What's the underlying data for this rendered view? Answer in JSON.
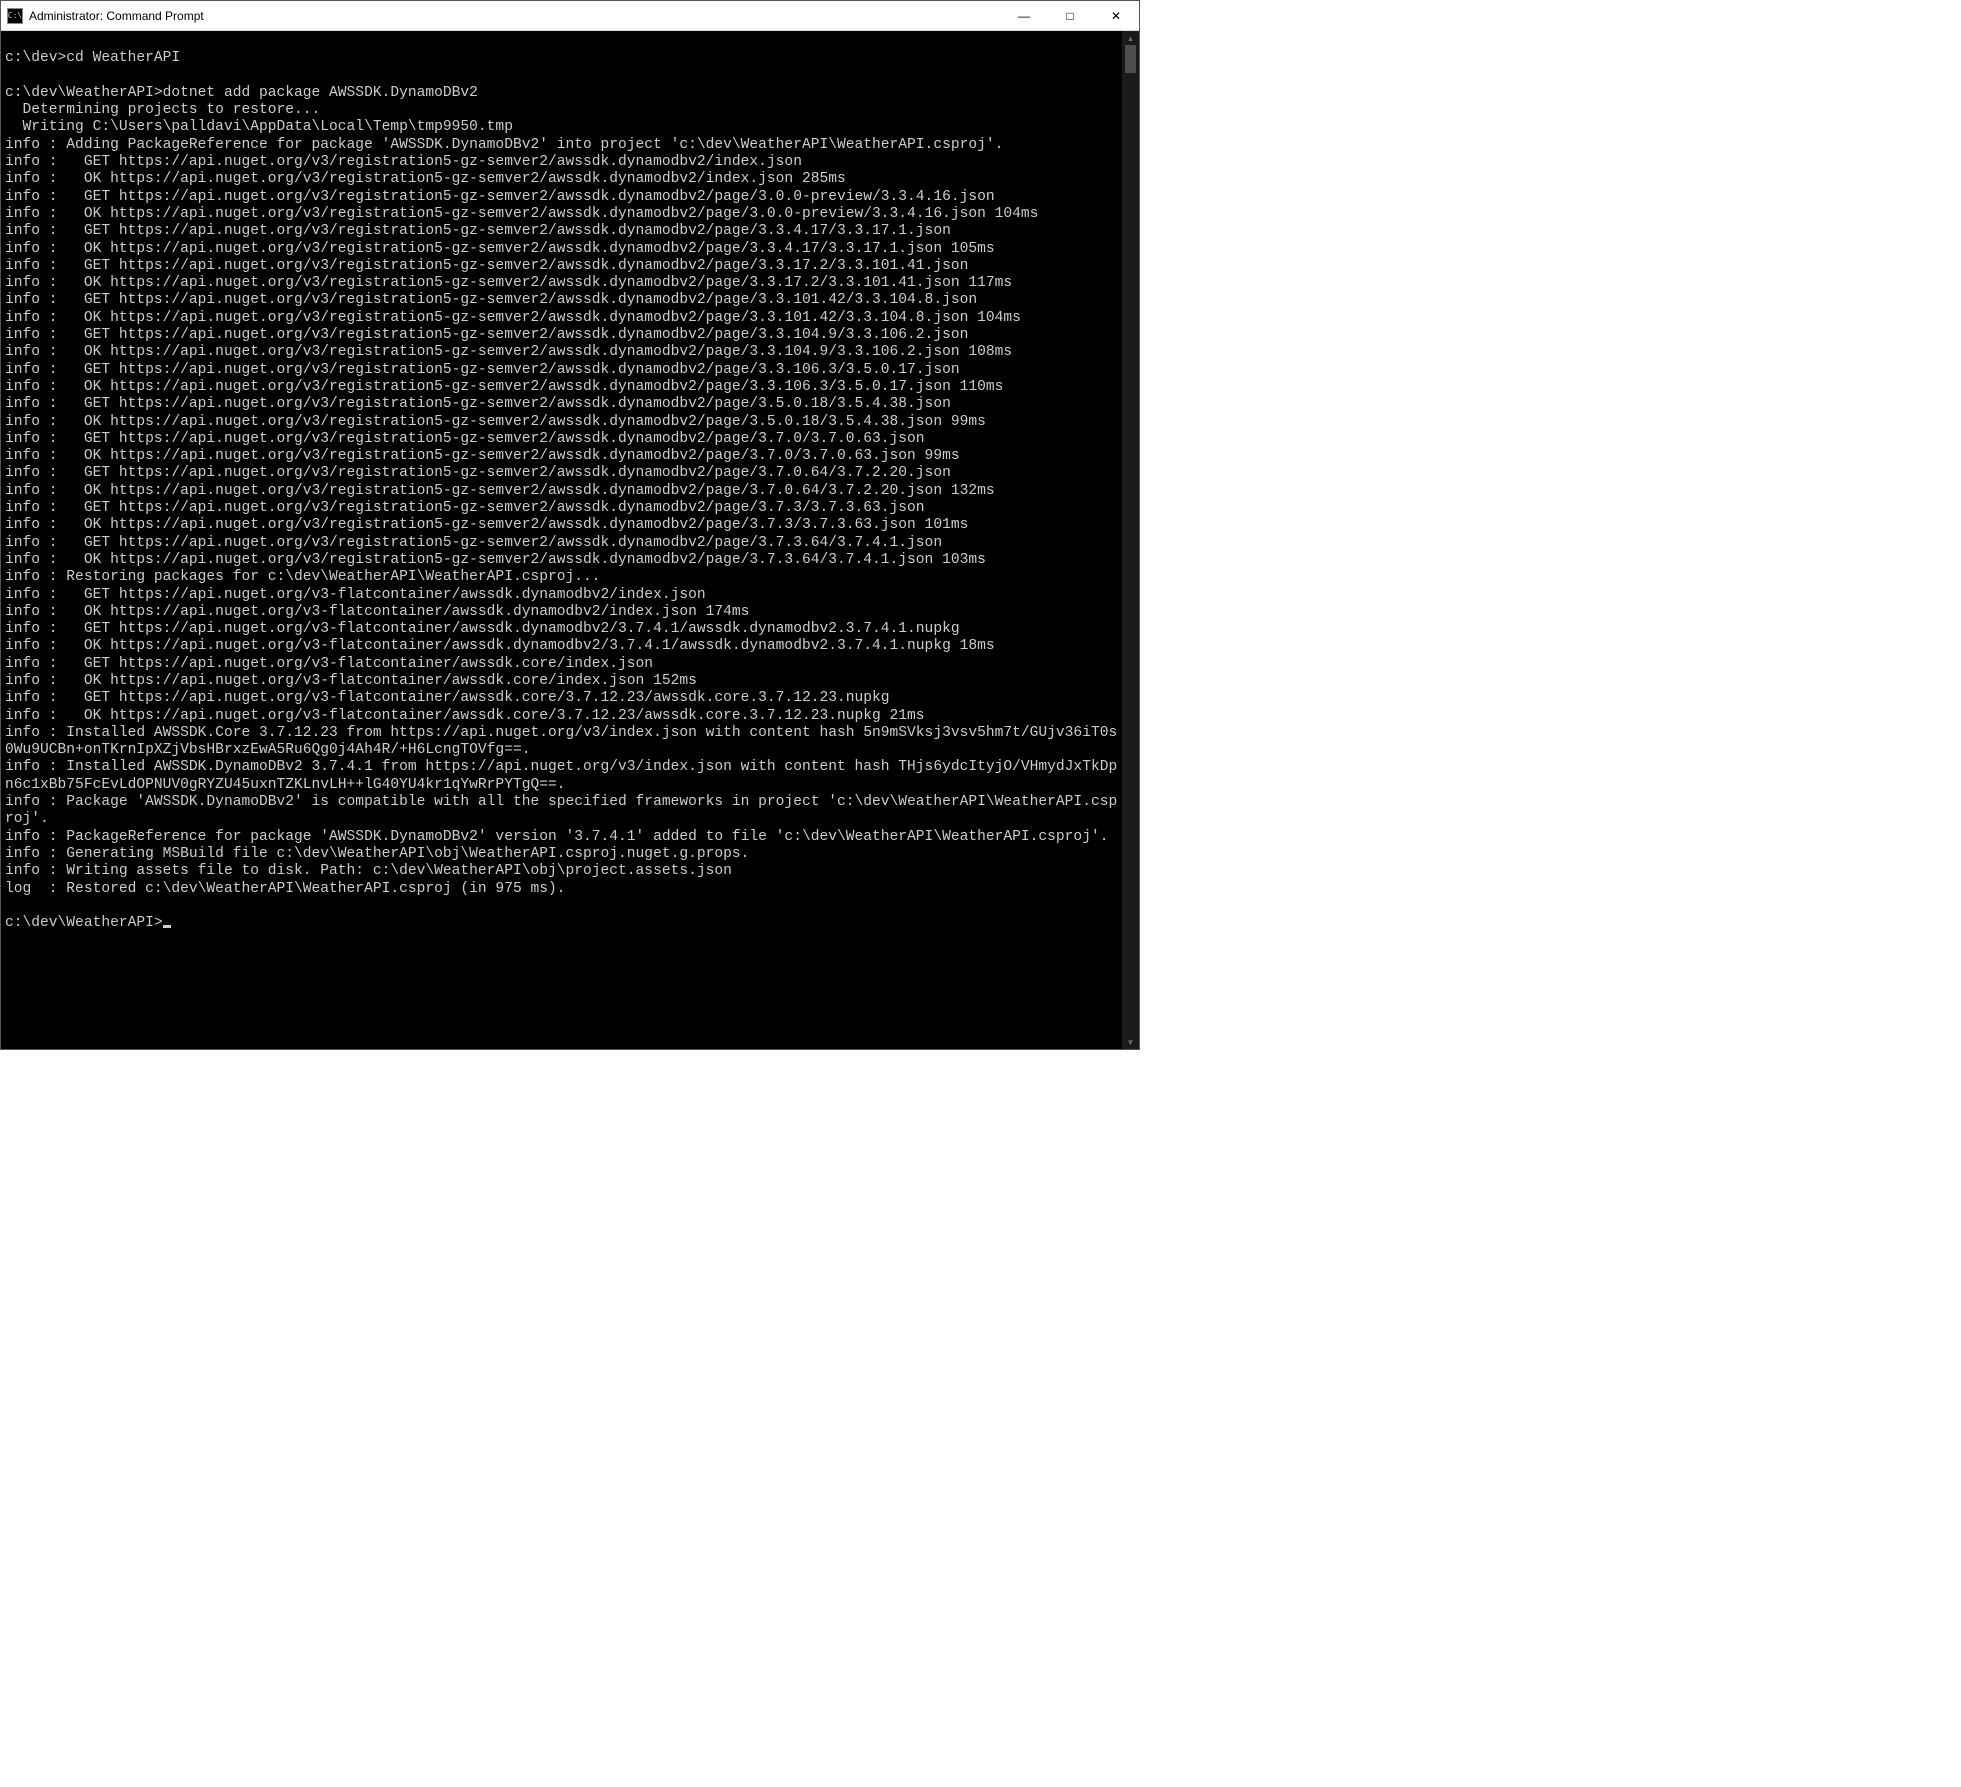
{
  "window": {
    "title": "Administrator: Command Prompt",
    "icon_label": "C:\\"
  },
  "terminal": {
    "lines": [
      "",
      "c:\\dev>cd WeatherAPI",
      "",
      "c:\\dev\\WeatherAPI>dotnet add package AWSSDK.DynamoDBv2",
      "  Determining projects to restore...",
      "  Writing C:\\Users\\palldavi\\AppData\\Local\\Temp\\tmp9950.tmp",
      "info : Adding PackageReference for package 'AWSSDK.DynamoDBv2' into project 'c:\\dev\\WeatherAPI\\WeatherAPI.csproj'.",
      "info :   GET https://api.nuget.org/v3/registration5-gz-semver2/awssdk.dynamodbv2/index.json",
      "info :   OK https://api.nuget.org/v3/registration5-gz-semver2/awssdk.dynamodbv2/index.json 285ms",
      "info :   GET https://api.nuget.org/v3/registration5-gz-semver2/awssdk.dynamodbv2/page/3.0.0-preview/3.3.4.16.json",
      "info :   OK https://api.nuget.org/v3/registration5-gz-semver2/awssdk.dynamodbv2/page/3.0.0-preview/3.3.4.16.json 104ms",
      "info :   GET https://api.nuget.org/v3/registration5-gz-semver2/awssdk.dynamodbv2/page/3.3.4.17/3.3.17.1.json",
      "info :   OK https://api.nuget.org/v3/registration5-gz-semver2/awssdk.dynamodbv2/page/3.3.4.17/3.3.17.1.json 105ms",
      "info :   GET https://api.nuget.org/v3/registration5-gz-semver2/awssdk.dynamodbv2/page/3.3.17.2/3.3.101.41.json",
      "info :   OK https://api.nuget.org/v3/registration5-gz-semver2/awssdk.dynamodbv2/page/3.3.17.2/3.3.101.41.json 117ms",
      "info :   GET https://api.nuget.org/v3/registration5-gz-semver2/awssdk.dynamodbv2/page/3.3.101.42/3.3.104.8.json",
      "info :   OK https://api.nuget.org/v3/registration5-gz-semver2/awssdk.dynamodbv2/page/3.3.101.42/3.3.104.8.json 104ms",
      "info :   GET https://api.nuget.org/v3/registration5-gz-semver2/awssdk.dynamodbv2/page/3.3.104.9/3.3.106.2.json",
      "info :   OK https://api.nuget.org/v3/registration5-gz-semver2/awssdk.dynamodbv2/page/3.3.104.9/3.3.106.2.json 108ms",
      "info :   GET https://api.nuget.org/v3/registration5-gz-semver2/awssdk.dynamodbv2/page/3.3.106.3/3.5.0.17.json",
      "info :   OK https://api.nuget.org/v3/registration5-gz-semver2/awssdk.dynamodbv2/page/3.3.106.3/3.5.0.17.json 110ms",
      "info :   GET https://api.nuget.org/v3/registration5-gz-semver2/awssdk.dynamodbv2/page/3.5.0.18/3.5.4.38.json",
      "info :   OK https://api.nuget.org/v3/registration5-gz-semver2/awssdk.dynamodbv2/page/3.5.0.18/3.5.4.38.json 99ms",
      "info :   GET https://api.nuget.org/v3/registration5-gz-semver2/awssdk.dynamodbv2/page/3.7.0/3.7.0.63.json",
      "info :   OK https://api.nuget.org/v3/registration5-gz-semver2/awssdk.dynamodbv2/page/3.7.0/3.7.0.63.json 99ms",
      "info :   GET https://api.nuget.org/v3/registration5-gz-semver2/awssdk.dynamodbv2/page/3.7.0.64/3.7.2.20.json",
      "info :   OK https://api.nuget.org/v3/registration5-gz-semver2/awssdk.dynamodbv2/page/3.7.0.64/3.7.2.20.json 132ms",
      "info :   GET https://api.nuget.org/v3/registration5-gz-semver2/awssdk.dynamodbv2/page/3.7.3/3.7.3.63.json",
      "info :   OK https://api.nuget.org/v3/registration5-gz-semver2/awssdk.dynamodbv2/page/3.7.3/3.7.3.63.json 101ms",
      "info :   GET https://api.nuget.org/v3/registration5-gz-semver2/awssdk.dynamodbv2/page/3.7.3.64/3.7.4.1.json",
      "info :   OK https://api.nuget.org/v3/registration5-gz-semver2/awssdk.dynamodbv2/page/3.7.3.64/3.7.4.1.json 103ms",
      "info : Restoring packages for c:\\dev\\WeatherAPI\\WeatherAPI.csproj...",
      "info :   GET https://api.nuget.org/v3-flatcontainer/awssdk.dynamodbv2/index.json",
      "info :   OK https://api.nuget.org/v3-flatcontainer/awssdk.dynamodbv2/index.json 174ms",
      "info :   GET https://api.nuget.org/v3-flatcontainer/awssdk.dynamodbv2/3.7.4.1/awssdk.dynamodbv2.3.7.4.1.nupkg",
      "info :   OK https://api.nuget.org/v3-flatcontainer/awssdk.dynamodbv2/3.7.4.1/awssdk.dynamodbv2.3.7.4.1.nupkg 18ms",
      "info :   GET https://api.nuget.org/v3-flatcontainer/awssdk.core/index.json",
      "info :   OK https://api.nuget.org/v3-flatcontainer/awssdk.core/index.json 152ms",
      "info :   GET https://api.nuget.org/v3-flatcontainer/awssdk.core/3.7.12.23/awssdk.core.3.7.12.23.nupkg",
      "info :   OK https://api.nuget.org/v3-flatcontainer/awssdk.core/3.7.12.23/awssdk.core.3.7.12.23.nupkg 21ms",
      "info : Installed AWSSDK.Core 3.7.12.23 from https://api.nuget.org/v3/index.json with content hash 5n9mSVksj3vsv5hm7t/GUjv36iT0s0Wu9UCBn+onTKrnIpXZjVbsHBrxzEwA5Ru6Qg0j4Ah4R/+H6LcngTOVfg==.",
      "info : Installed AWSSDK.DynamoDBv2 3.7.4.1 from https://api.nuget.org/v3/index.json with content hash THjs6ydcItyjO/VHmydJxTkDpn6c1xBb75FcEvLdOPNUV0gRYZU45uxnTZKLnvLH++lG40YU4kr1qYwRrPYTgQ==.",
      "info : Package 'AWSSDK.DynamoDBv2' is compatible with all the specified frameworks in project 'c:\\dev\\WeatherAPI\\WeatherAPI.csproj'.",
      "info : PackageReference for package 'AWSSDK.DynamoDBv2' version '3.7.4.1' added to file 'c:\\dev\\WeatherAPI\\WeatherAPI.csproj'.",
      "info : Generating MSBuild file c:\\dev\\WeatherAPI\\obj\\WeatherAPI.csproj.nuget.g.props.",
      "info : Writing assets file to disk. Path: c:\\dev\\WeatherAPI\\obj\\project.assets.json",
      "log  : Restored c:\\dev\\WeatherAPI\\WeatherAPI.csproj (in 975 ms).",
      "",
      "c:\\dev\\WeatherAPI>"
    ]
  }
}
